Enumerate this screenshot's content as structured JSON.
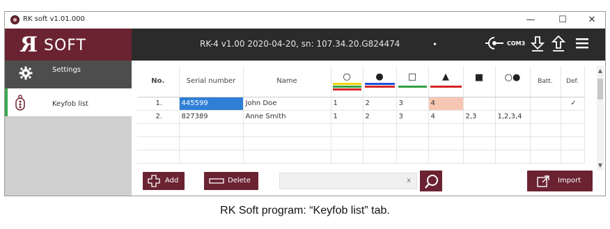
{
  "window": {
    "title": "RK soft v1.01.000",
    "controls": {
      "minimize": "—",
      "maximize": "☐",
      "close": "✕"
    }
  },
  "header": {
    "logo_mark": "R",
    "logo_text": "SOFT",
    "device_info": "RK-4 v1.00 2020-04-20, sn: 107.34.20.G824474",
    "connection_indicator": "•",
    "com_port": "COM3",
    "icons": [
      "connect-icon",
      "download-icon",
      "upload-icon",
      "menu-icon"
    ]
  },
  "sidebar": {
    "items": [
      {
        "label": "Settings",
        "icon": "gear-icon",
        "active": false
      },
      {
        "label": "Keyfob list",
        "icon": "keyfob-icon",
        "active": true
      }
    ]
  },
  "table": {
    "headers": {
      "no": "No.",
      "serial": "Serial number",
      "name": "Name",
      "batt": "Batt.",
      "def": "Def."
    },
    "button_columns": [
      {
        "symbol": "○",
        "bars": [
          "#f0d400",
          "#2ea043",
          "#d42525"
        ]
      },
      {
        "symbol": "●",
        "bars": [
          "#1e4fd8",
          "#d42525"
        ]
      },
      {
        "symbol": "□",
        "bars": [
          "#2ea043"
        ]
      },
      {
        "symbol": "▲",
        "bars": [
          "#d42525"
        ]
      },
      {
        "symbol": "■",
        "bars": []
      },
      {
        "symbol": "○●",
        "bars": []
      }
    ],
    "rows": [
      {
        "no": "1.",
        "serial": "445599",
        "name": "John Doe",
        "b1": "1",
        "b2": "2",
        "b3": "3",
        "b4": "4",
        "b5": "",
        "b6": "",
        "batt": "",
        "def": "✓"
      },
      {
        "no": "2.",
        "serial": "827389",
        "name": "Anne Smith",
        "b1": "1",
        "b2": "2",
        "b3": "3",
        "b4": "4",
        "b5": "2,3",
        "b6": "1,2,3,4",
        "batt": "",
        "def": ""
      }
    ],
    "empty_rows": 3
  },
  "actions": {
    "add_label": "Add",
    "delete_label": "Delete",
    "search_value": "",
    "search_clear": "x",
    "import_label": "Import"
  },
  "caption": "RK Soft program: “Keyfob list” tab.",
  "colors": {
    "brand": "#6b2331",
    "header_bg": "#2b2b2b",
    "selection": "#2f7fd6",
    "active_indicator": "#3aa850",
    "highlight_cell": "#f7c7b4"
  }
}
